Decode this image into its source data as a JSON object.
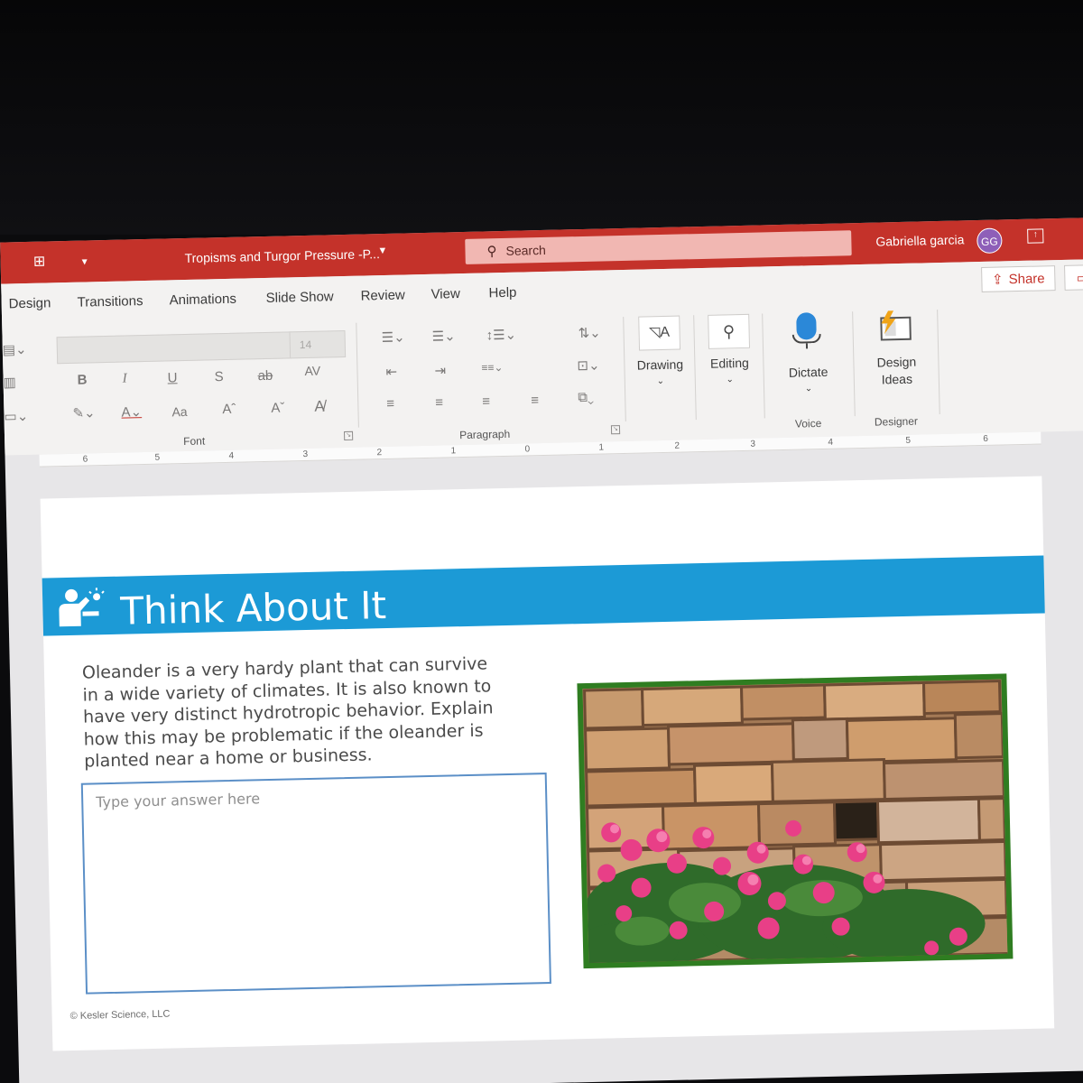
{
  "titlebar": {
    "doc_title": "Tropisms and Turgor Pressure -P...",
    "search_label": "Search",
    "user_name": "Gabriella garcia",
    "user_initials": "GG"
  },
  "tabs": [
    "Design",
    "Transitions",
    "Animations",
    "Slide Show",
    "Review",
    "View",
    "Help"
  ],
  "share_label": "Share",
  "ribbon": {
    "font_size": "14",
    "font_group": "Font",
    "paragraph_group": "Paragraph",
    "drawing_label": "Drawing",
    "editing_label": "Editing",
    "dictate_label": "Dictate",
    "design_ideas_line1": "Design",
    "design_ideas_line2": "Ideas",
    "voice_group": "Voice",
    "designer_group": "Designer",
    "bold": "B",
    "italic": "I",
    "underline": "U",
    "shadow": "S",
    "strike": "ab",
    "spacing": "AV",
    "change_case": "Aa",
    "grow": "Aˆ",
    "shrink": "Aˇ"
  },
  "ruler": [
    "6",
    "5",
    "4",
    "3",
    "2",
    "1",
    "0",
    "1",
    "2",
    "3",
    "4",
    "5",
    "6"
  ],
  "slide": {
    "heading": "Think About It",
    "question_lines": [
      "Oleander is a very hardy plant that can survive",
      "in a wide variety of climates. It is also known to",
      "have very distinct hydrotropic behavior. Explain",
      "how this may be problematic if the oleander is",
      "planted near a home or business."
    ],
    "answer_placeholder": "Type your answer here",
    "copyright": "© Kesler Science, LLC"
  },
  "colors": {
    "titlebar": "#c4322a",
    "banner": "#1c9ad6",
    "photo_frame": "#2f7d21",
    "answer_border": "#5b8fc7"
  }
}
